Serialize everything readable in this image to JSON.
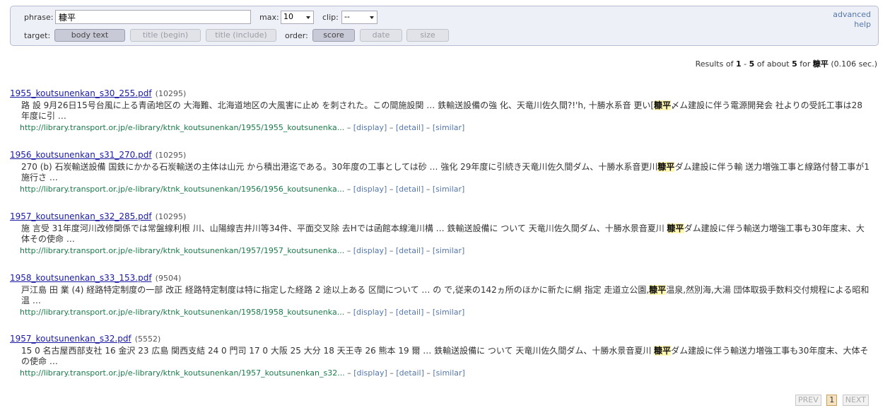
{
  "form": {
    "phrase_label": "phrase:",
    "phrase_value": "糠平",
    "max_label": "max:",
    "max_value": "10",
    "clip_label": "clip:",
    "clip_value": "--",
    "target_label": "target:",
    "target_buttons": [
      "body text",
      "title (begin)",
      "title (include)"
    ],
    "order_label": "order:",
    "order_buttons": [
      "score",
      "date",
      "size"
    ],
    "advanced_link": "advanced",
    "help_link": "help"
  },
  "summary": {
    "prefix": "Results of",
    "start": "1",
    "dash": "-",
    "end": "5",
    "of_about": "of about",
    "total": "5",
    "for": "for",
    "query": "糠平",
    "time": "(0.106 sec.)"
  },
  "results": [
    {
      "title": "1955_koutsunenkan_s30_255.pdf",
      "size": "(10295)",
      "snippet_pre": "路 設 9月26日15号台風に上る青函地区の 大海難、北海道地区の大風害に止め を刺された。この間施設関 … 鉄輸送設備の強 化、天竜川佐久間?!'h, 十勝水系音 更い[",
      "snippet_hl": "糠平",
      "snippet_post": "〆ム建設に伴う電源開発会 社よりの受託工事は28年度に引 …",
      "url": "http://library.transport.or.jp/e-library/ktnk_koutsunenkan/1955/1955_koutsunenka..."
    },
    {
      "title": "1956_koutsunenkan_s31_270.pdf",
      "size": "(10295)",
      "snippet_pre": "270 (b) 石炭輸送設備 国鉄にかかる石炭輸送の主体は山元 から積出港迄である。30年度の工事としては砂 … 強化 29年度に引続き天竜川佐久間ダム、十勝水系音更川",
      "snippet_hl": "糠平",
      "snippet_post": "ダム建設に伴う輸 送力増強工事と線路付替工事が1施行さ …",
      "url": "http://library.transport.or.jp/e-library/ktnk_koutsunenkan/1956/1956_koutsunenka..."
    },
    {
      "title": "1957_koutsunenkan_s32_285.pdf",
      "size": "(10295)",
      "snippet_pre": "施 言受 31年度河川改修関係では常盤線利根 川、山陽線吉井川等34件、平面交叉除 去Hでは函館本線滝川構 … 鉄輸送設備に ついて 天竜川佐久間ダム、十勝水景音夏川 ",
      "snippet_hl": "糠平",
      "snippet_post": "ダム建設に伴う輸送力増強工事も30年度末、大体その使命 …",
      "url": "http://library.transport.or.jp/e-library/ktnk_koutsunenkan/1957/1957_koutsunenka..."
    },
    {
      "title": "1958_koutsunenkan_s33_153.pdf",
      "size": "(9504)",
      "snippet_pre": "戸江島 田 業 (4) 経路特定制度の一部 改正 経路特定制度は特に指定した経路 2 途以上ある 区間について … の で,従来の142ヵ所のほかに新たに網 指定 走道立公園,",
      "snippet_hl": "糠平",
      "snippet_post": "温泉,然別海,大湯 団体取扱手数料交付規程による昭和 温 …",
      "url": "http://library.transport.or.jp/e-library/ktnk_koutsunenkan/1958/1958_koutsunenka..."
    },
    {
      "title": "1957_koutsunenkan_s32.pdf",
      "size": "(5552)",
      "snippet_pre": "15 0 名古屋西部支社 16 金沢 23 広島 関西支結 24 0 門司 17 0 大阪 25 大分 18 天王寺 26 熊本 19 爾 … 鉄輸送設備に ついて 天竜川佐久間ダム、十勝水景音夏川 ",
      "snippet_hl": "糠平",
      "snippet_post": "ダム建設に伴う輸送力増強工事も30年度末、大体その使命 …",
      "url": "http://library.transport.or.jp/e-library/ktnk_koutsunenkan/1957_koutsunenkan_s32..."
    }
  ],
  "result_actions": {
    "sep": "–",
    "display": "[display]",
    "detail": "[detail]",
    "similar": "[similar]"
  },
  "pager": {
    "prev": "PREV",
    "current": "1",
    "next": "NEXT"
  }
}
